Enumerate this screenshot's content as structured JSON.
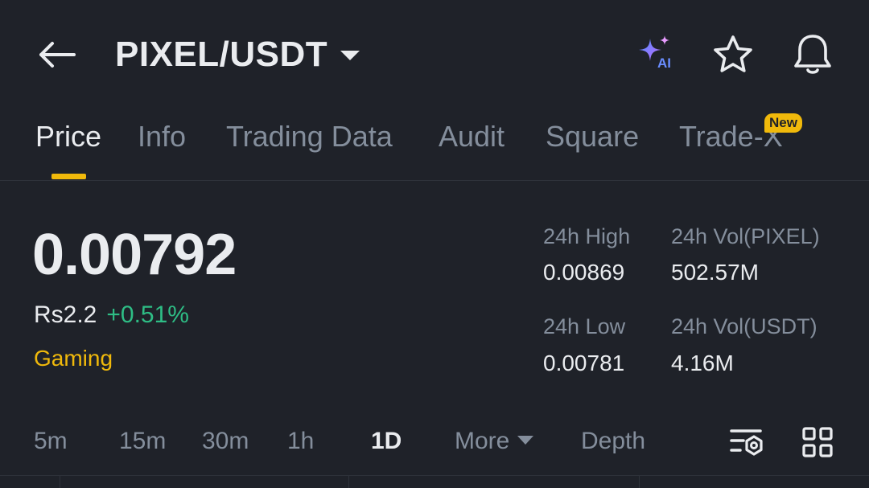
{
  "header": {
    "pair": "PIXEL/USDT",
    "ai_label": "AI"
  },
  "tabs": [
    {
      "label": "Price",
      "active": true
    },
    {
      "label": "Info"
    },
    {
      "label": "Trading Data"
    },
    {
      "label": "Audit"
    },
    {
      "label": "Square"
    },
    {
      "label": "Trade-X"
    }
  ],
  "badge": {
    "new": "New"
  },
  "ticker": {
    "price": "0.00792",
    "fiat": "Rs2.2",
    "change": "+0.51%",
    "tag": "Gaming"
  },
  "stats": {
    "high_label": "24h High",
    "high_value": "0.00869",
    "vol_base_label": "24h Vol(PIXEL)",
    "vol_base_value": "502.57M",
    "low_label": "24h Low",
    "low_value": "0.00781",
    "vol_quote_label": "24h Vol(USDT)",
    "vol_quote_value": "4.16M"
  },
  "intervals": {
    "items": [
      "5m",
      "15m",
      "30m",
      "1h",
      "1D",
      "More",
      "Depth"
    ],
    "active": "1D"
  },
  "colors": {
    "background": "#1f2229",
    "accent": "#f0b90b",
    "positive": "#2ebd85",
    "muted": "#848e9c",
    "text": "#eaecef"
  },
  "icons": [
    "back-arrow-icon",
    "ai-sparkle-icon",
    "star-icon",
    "bell-icon",
    "indicator-settings-icon",
    "grid-layout-icon"
  ]
}
